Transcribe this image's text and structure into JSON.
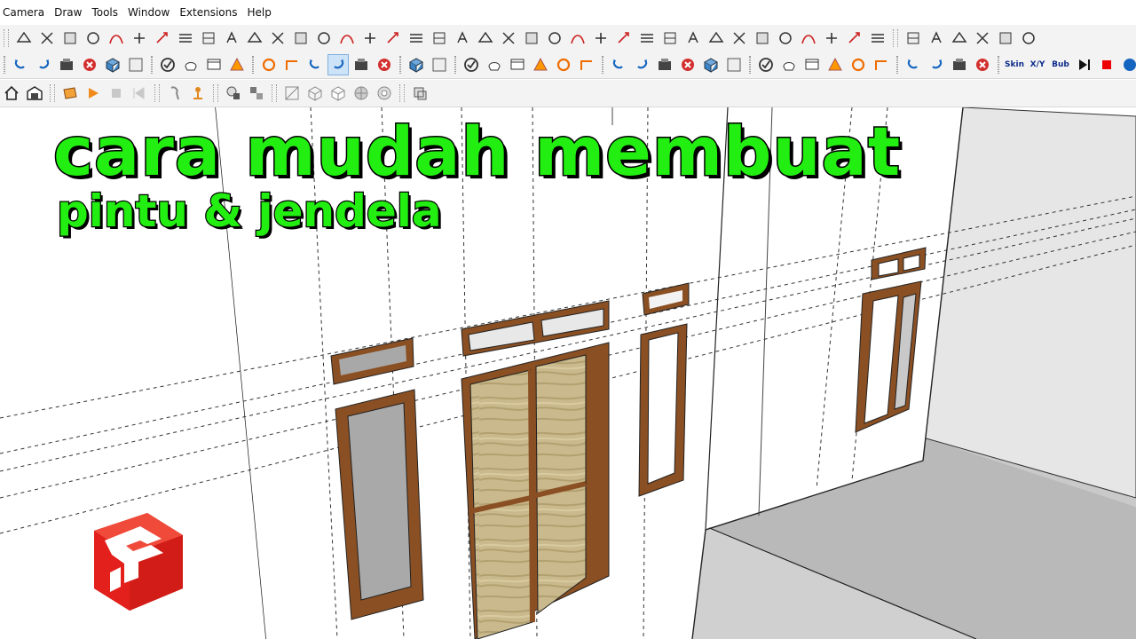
{
  "menu": {
    "items": [
      "Camera",
      "Draw",
      "Tools",
      "Window",
      "Extensions",
      "Help"
    ]
  },
  "toolbar3": {
    "skin_label": "Skin",
    "xy_label": "X/Y",
    "bub_label": "Bub"
  },
  "thumbnail": {
    "title_line1": "cara mudah membuat",
    "title_line2": "pintu & jendela"
  },
  "colors": {
    "title_green": "#22ee11",
    "wood": "#8a4f22",
    "logo_red": "#e3201b"
  },
  "icons": {
    "logo": "sketchup-logo-icon",
    "home": "home-icon",
    "warehouse": "warehouse-icon"
  }
}
